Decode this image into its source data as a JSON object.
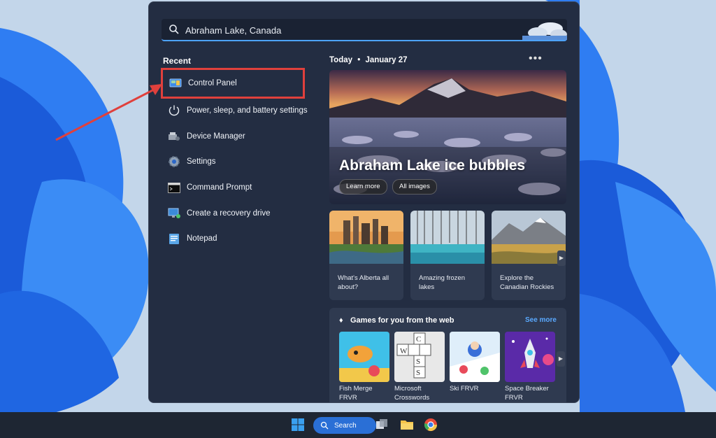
{
  "search": {
    "value": "Abraham Lake, Canada",
    "icon": "search-icon"
  },
  "recent": {
    "title": "Recent",
    "items": [
      {
        "label": "Control Panel",
        "icon": "control-panel-icon"
      },
      {
        "label": "Power, sleep, and battery settings",
        "icon": "power-icon"
      },
      {
        "label": "Device Manager",
        "icon": "device-manager-icon"
      },
      {
        "label": "Settings",
        "icon": "gear-icon"
      },
      {
        "label": "Command Prompt",
        "icon": "terminal-icon"
      },
      {
        "label": "Create a recovery drive",
        "icon": "recovery-drive-icon"
      },
      {
        "label": "Notepad",
        "icon": "notepad-icon"
      }
    ]
  },
  "today": {
    "label": "Today",
    "separator": "•",
    "date": "January 27",
    "more": "•••"
  },
  "hero": {
    "title": "Abraham Lake ice bubbles",
    "learn_more": "Learn more",
    "all_images": "All images"
  },
  "cards": [
    {
      "caption": "What's Alberta all about?"
    },
    {
      "caption": "Amazing frozen lakes"
    },
    {
      "caption": "Explore the Canadian Rockies"
    }
  ],
  "games": {
    "title": "Games for you from the web",
    "see_more": "See more",
    "items": [
      {
        "name": "Fish Merge FRVR"
      },
      {
        "name": "Microsoft Crosswords"
      },
      {
        "name": "Ski FRVR"
      },
      {
        "name": "Space Breaker FRVR"
      }
    ]
  },
  "taskbar": {
    "search_label": "Search"
  },
  "colors": {
    "accent": "#2a6fd6",
    "highlight_box": "#e0403c",
    "panel": "#232d42"
  }
}
